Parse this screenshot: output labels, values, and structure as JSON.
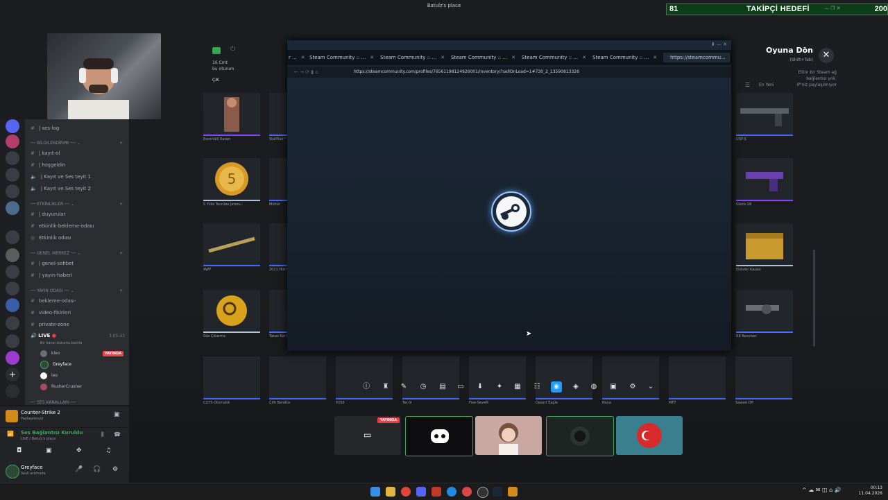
{
  "top_title": "Batulz's place",
  "follow_goal": {
    "current": "81",
    "label": "TAKİPÇİ HEDEFİ",
    "target": "200"
  },
  "game_overlay": {
    "return_title": "Oyuna Dön",
    "return_shortcut": "(Shift+Tab)",
    "connection_note_1": "Etkin bir Steam ağ",
    "connection_note_2": "bağlantısı yok.",
    "connection_note_3": "IP'niz paylaşılmıyor",
    "sort_label": "En Yeni",
    "left_header_1": "16 Cmt",
    "left_header_2": "bu oturum",
    "left_button": "ÇIK"
  },
  "steam_window": {
    "tabs": [
      {
        "label": "r ..."
      },
      {
        "label": "Steam Community :: ..."
      },
      {
        "label": "Steam Community :: ..."
      },
      {
        "label": "Steam Community :: ..."
      },
      {
        "label": "Steam Community :: ..."
      },
      {
        "label": "Steam Community :: ..."
      },
      {
        "label": "https://steamcommu..."
      }
    ],
    "url": "https://steamcommunity.com/profiles/76561198124926001/inventory/?sellOnLoad=1#730_2_13590813326"
  },
  "inventory_items": [
    {
      "name": "Escorükli Razan"
    },
    {
      "name": "StatTrak™"
    },
    {
      "name": "5 Yıllık Tecrübe Jetonu"
    },
    {
      "name": "Mühür"
    },
    {
      "name": "AWP"
    },
    {
      "name": "2021 Hizmet"
    },
    {
      "name": "Göz Çıkarma"
    },
    {
      "name": "Takas Kartı"
    },
    {
      "name": "USP-S"
    },
    {
      "name": "Glock-18"
    },
    {
      "name": "Eldiven Kasası"
    },
    {
      "name": "R8 Revolver"
    },
    {
      "name": "CZ75-Otomatik"
    },
    {
      "name": "Çifti Beretta"
    },
    {
      "name": "P250"
    },
    {
      "name": "Tec-9"
    },
    {
      "name": "Five-SeveN"
    },
    {
      "name": "Desert Eagle"
    },
    {
      "name": "Nova"
    },
    {
      "name": "MP7"
    },
    {
      "name": "Sawed-Off"
    }
  ],
  "discord": {
    "channels": [
      {
        "label": "| ses-log"
      },
      {
        "label": "BİLGİLENDİRME"
      },
      {
        "label": "| kayıt-ol"
      },
      {
        "label": "| hoşgeldin"
      },
      {
        "label": "| Kayıt ve Ses teyit 1"
      },
      {
        "label": "| Kayıt ve Ses teyit 2"
      },
      {
        "label": "ETKİNLİKLER"
      },
      {
        "label": "| duyurular"
      },
      {
        "label": "etkinlik-bekleme-odası"
      },
      {
        "label": "Etkinlik odası"
      },
      {
        "label": "GENEL MERKEZ"
      },
      {
        "label": "| genel-sohbet"
      },
      {
        "label": "| yayın-haberi"
      },
      {
        "label": "YAYIN ODASI"
      },
      {
        "label": "bekleme-odası-"
      },
      {
        "label": "video-fikirleri"
      },
      {
        "label": "private-zone"
      }
    ],
    "live_channel": "LIVE",
    "live_time": "3:05:33",
    "live_sub": "Bir kanal durumu belirle",
    "live_badge": "YAYINDA",
    "members": [
      {
        "name": "kleo"
      },
      {
        "name": "Greyface"
      },
      {
        "name": "leo"
      },
      {
        "name": "RusherCrusher"
      }
    ],
    "bottom_category": "SES KANALLARI",
    "activity_title": "Counter-Strike 2",
    "activity_sub": "Paylaşılmıyor",
    "voice_title": "Ses Bağlantısı Kuruldu",
    "voice_sub": "LIVE / Batulz's place",
    "user_name": "Greyface",
    "user_status": "Sesli aramada"
  },
  "stream_tiles": {
    "first_badge": "YAYINDA"
  },
  "taskbar": {
    "time": "00:13",
    "date": "11.04.2026"
  },
  "colors": {
    "goal_bg": "#0c3d18",
    "live_red": "#ed4245",
    "rarity_blue": "#4b69ff",
    "steam_blue": "#1b2838"
  }
}
